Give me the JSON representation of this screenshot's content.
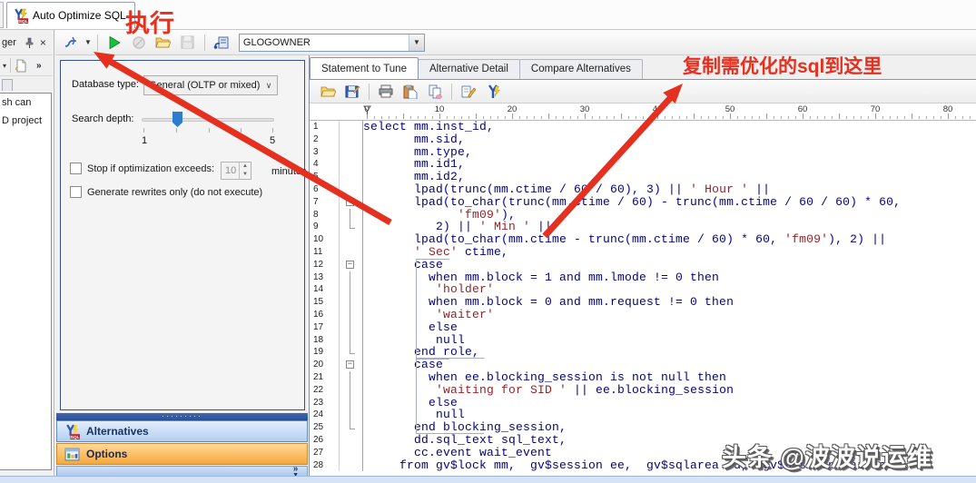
{
  "window": {
    "tab_title": "Auto Optimize SQL"
  },
  "annotations": {
    "execute_label": "执行",
    "copy_sql_label": "复制需优化的sql到这里",
    "watermark": "头条 @波波说运维",
    "accent_color": "#e6301f"
  },
  "sidebar": {
    "header_title_partial": "ger",
    "close_glyph": "×",
    "dropdown_glyph": "▾",
    "overflow_chevron": "»",
    "items": [
      {
        "label": "sh can"
      },
      {
        "label": "D project"
      }
    ]
  },
  "main_toolbar": {
    "connection_value": "GLOGOWNER",
    "combo_arrow": "▼"
  },
  "options_panel": {
    "database_type_label": "Database type:",
    "database_type_value": "General (OLTP or mixed)",
    "database_type_chevron": "∨",
    "search_depth_label": "Search depth:",
    "search_depth_min": "1",
    "search_depth_max": "5",
    "stop_checkbox_label": "Stop if optimization exceeds:",
    "stop_minutes_value": "10",
    "stop_minutes_unit": "minutes",
    "rewrites_checkbox_label": "Generate rewrites only (do not execute)"
  },
  "panels": {
    "alternatives_label": "Alternatives",
    "options_label": "Options",
    "collapse_chevron": "»",
    "splitter_grip": "·········"
  },
  "editor": {
    "tabs": [
      {
        "label": "Statement to Tune",
        "active": true
      },
      {
        "label": "Alternative Detail",
        "active": false
      },
      {
        "label": "Compare Alternatives",
        "active": false
      }
    ],
    "ruler_marks": [
      "0",
      "10",
      "20",
      "30",
      "40",
      "50",
      "60",
      "70",
      "80"
    ],
    "syntax_colors": {
      "code": "#00008b",
      "string": "#9c1f26"
    },
    "lines": [
      {
        "n": 1,
        "f": "",
        "segs": [
          [
            "c",
            "select mm.inst_id,"
          ]
        ]
      },
      {
        "n": 2,
        "f": "",
        "segs": [
          [
            "c",
            "       mm.sid,"
          ]
        ]
      },
      {
        "n": 3,
        "f": "",
        "segs": [
          [
            "c",
            "       mm.type,"
          ]
        ]
      },
      {
        "n": 4,
        "f": "",
        "segs": [
          [
            "c",
            "       mm.id1,"
          ]
        ]
      },
      {
        "n": 5,
        "f": "",
        "segs": [
          [
            "c",
            "       mm.id2,"
          ]
        ]
      },
      {
        "n": 6,
        "f": "",
        "segs": [
          [
            "c",
            "       lpad(trunc(mm.ctime / 60 / 60), 3) || "
          ],
          [
            "s",
            "' Hour '"
          ],
          [
            "c",
            " ||"
          ]
        ]
      },
      {
        "n": 7,
        "f": "box",
        "segs": [
          [
            "c",
            "       lpad(to_char(trunc(mm.ctime / 60) - trunc(mm.ctime / 60 / 60) * 60,"
          ]
        ]
      },
      {
        "n": 8,
        "f": "mid",
        "segs": [
          [
            "c",
            "             "
          ],
          [
            "s",
            "'fm09'"
          ],
          [
            "c",
            "),"
          ]
        ]
      },
      {
        "n": 9,
        "f": "end",
        "segs": [
          [
            "c",
            "          2) || "
          ],
          [
            "s",
            "' Min '"
          ],
          [
            "c",
            " ||"
          ]
        ]
      },
      {
        "n": 10,
        "f": "",
        "segs": [
          [
            "c",
            "       lpad(to_char(mm.ctime - trunc(mm.ctime / 60) * 60, "
          ],
          [
            "s",
            "'fm09'"
          ],
          [
            "c",
            "), 2) ||"
          ]
        ]
      },
      {
        "n": 11,
        "f": "",
        "segs": [
          [
            "c",
            "       "
          ],
          [
            "s",
            "' Sec'"
          ],
          [
            "c",
            " ctime,"
          ]
        ]
      },
      {
        "n": 12,
        "f": "box",
        "segs": [
          [
            "c",
            "       case"
          ]
        ]
      },
      {
        "n": 13,
        "f": "mid",
        "segs": [
          [
            "c",
            "         when mm.block = 1 and mm.lmode != 0 then"
          ]
        ]
      },
      {
        "n": 14,
        "f": "mid",
        "segs": [
          [
            "c",
            "          "
          ],
          [
            "s",
            "'holder'"
          ]
        ]
      },
      {
        "n": 15,
        "f": "mid",
        "segs": [
          [
            "c",
            "         when mm.block = 0 and mm.request != 0 then"
          ]
        ]
      },
      {
        "n": 16,
        "f": "mid",
        "segs": [
          [
            "c",
            "          "
          ],
          [
            "s",
            "'waiter'"
          ]
        ]
      },
      {
        "n": 17,
        "f": "mid",
        "segs": [
          [
            "c",
            "         else"
          ]
        ]
      },
      {
        "n": 18,
        "f": "mid",
        "segs": [
          [
            "c",
            "          null"
          ]
        ]
      },
      {
        "n": 19,
        "f": "end",
        "segs": [
          [
            "c",
            "       end role,"
          ]
        ]
      },
      {
        "n": 20,
        "f": "box",
        "segs": [
          [
            "c",
            "       case"
          ]
        ]
      },
      {
        "n": 21,
        "f": "mid",
        "segs": [
          [
            "c",
            "         when ee.blocking_session is not null then"
          ]
        ]
      },
      {
        "n": 22,
        "f": "mid",
        "segs": [
          [
            "c",
            "          "
          ],
          [
            "s",
            "'waiting for SID '"
          ],
          [
            "c",
            " || ee.blocking_session"
          ]
        ]
      },
      {
        "n": 23,
        "f": "mid",
        "segs": [
          [
            "c",
            "         else"
          ]
        ]
      },
      {
        "n": 24,
        "f": "mid",
        "segs": [
          [
            "c",
            "          null"
          ]
        ]
      },
      {
        "n": 25,
        "f": "end",
        "segs": [
          [
            "c",
            "       end blocking_session,"
          ]
        ]
      },
      {
        "n": 26,
        "f": "",
        "segs": [
          [
            "c",
            "       dd.sql_text sql_text,"
          ]
        ]
      },
      {
        "n": 27,
        "f": "",
        "segs": [
          [
            "c",
            "       cc.event wait_event"
          ]
        ]
      },
      {
        "n": 28,
        "f": "",
        "segs": [
          [
            "c",
            "     from gv$lock mm,  gv$session ee,  gv$sqlarea dd,  gv$session_wait cc"
          ]
        ]
      }
    ]
  }
}
